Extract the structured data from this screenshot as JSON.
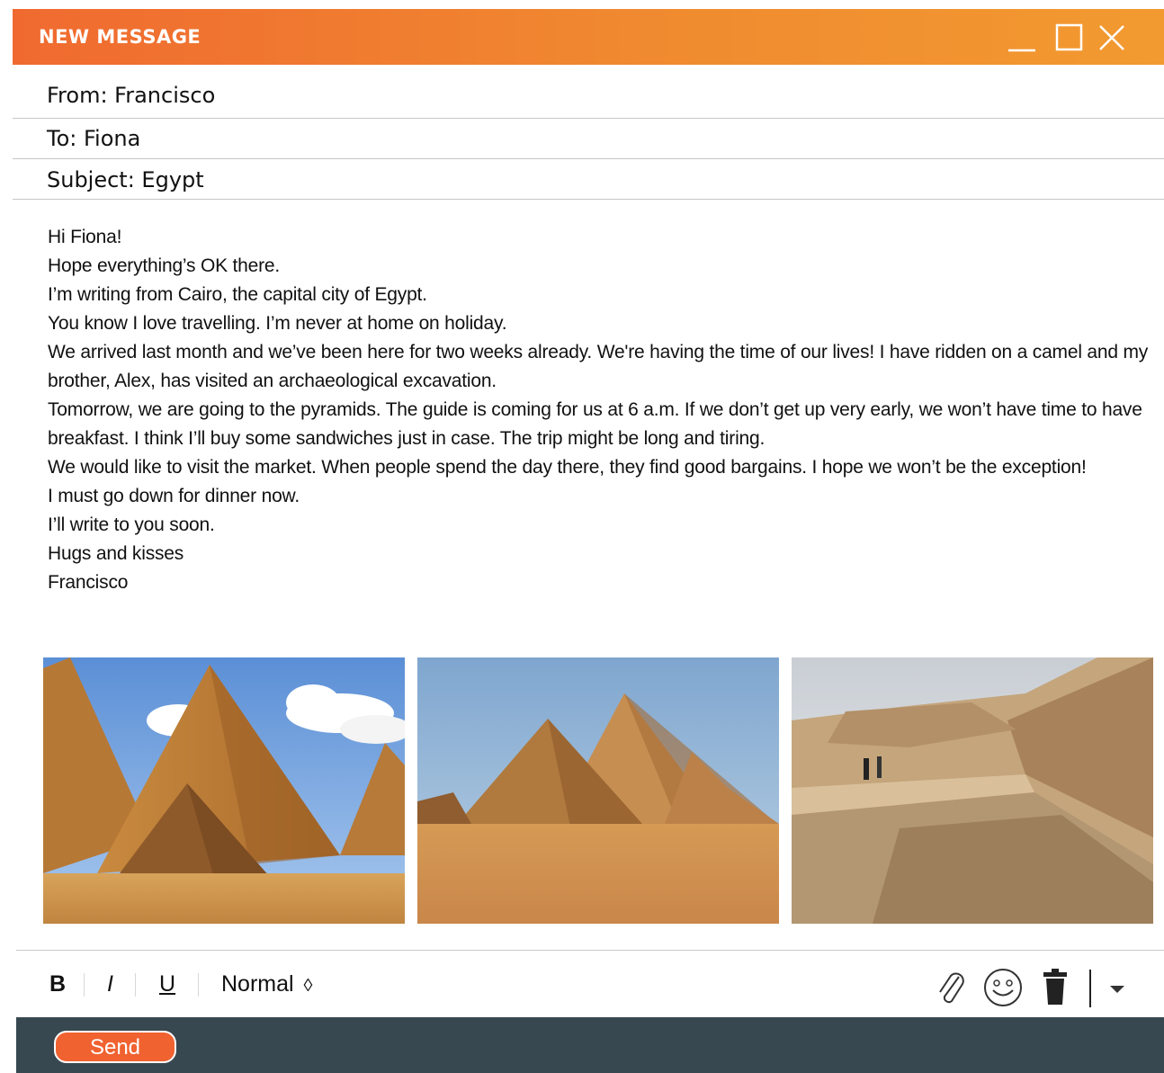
{
  "window": {
    "title": "NEW MESSAGE",
    "controls": [
      "minimize-icon",
      "maximize-icon",
      "close-icon"
    ]
  },
  "header": {
    "from": "From: Francisco",
    "to": "To: Fiona",
    "subject": "Subject: Egypt"
  },
  "body": {
    "lines": [
      "Hi Fiona!",
      "Hope everything’s OK there.",
      "I’m writing from Cairo, the capital city of Egypt.",
      "You know I love travelling. I’m never at home on holiday.",
      "We arrived last month and we’ve been here for two weeks already. We're having the time of our lives! I have ridden on a camel and my brother, Alex, has visited an archaeological excavation.",
      "Tomorrow, we are going to the pyramids. The guide is coming for us at 6 a.m. If we don’t get up very early, we won’t have time to have breakfast. I think I’ll buy some sandwiches just in case. The trip might be long and tiring.",
      "We would like to visit the market. When people spend the day there, they find good bargains. I hope we won’t be the exception!",
      "I must go down for dinner now.",
      "I’ll write to you soon.",
      "Hugs and kisses",
      "Francisco"
    ]
  },
  "attachments": [
    {
      "subject": "pyramids-photo"
    },
    {
      "subject": "pyramids-desert-photo"
    },
    {
      "subject": "valley-excavation-photo"
    }
  ],
  "toolbar": {
    "bold": "B",
    "italic": "I",
    "underline": "U",
    "format": "Normal",
    "format_arrows": "◊",
    "icons": [
      "paperclip-icon",
      "smiley-icon",
      "trash-icon",
      "more-chevron-icon"
    ]
  },
  "footer": {
    "send_label": "Send"
  },
  "colors": {
    "titlebar_start": "#f06a30",
    "titlebar_end": "#f29a30",
    "footer_bg": "#384850",
    "send_button": "#f06230"
  }
}
